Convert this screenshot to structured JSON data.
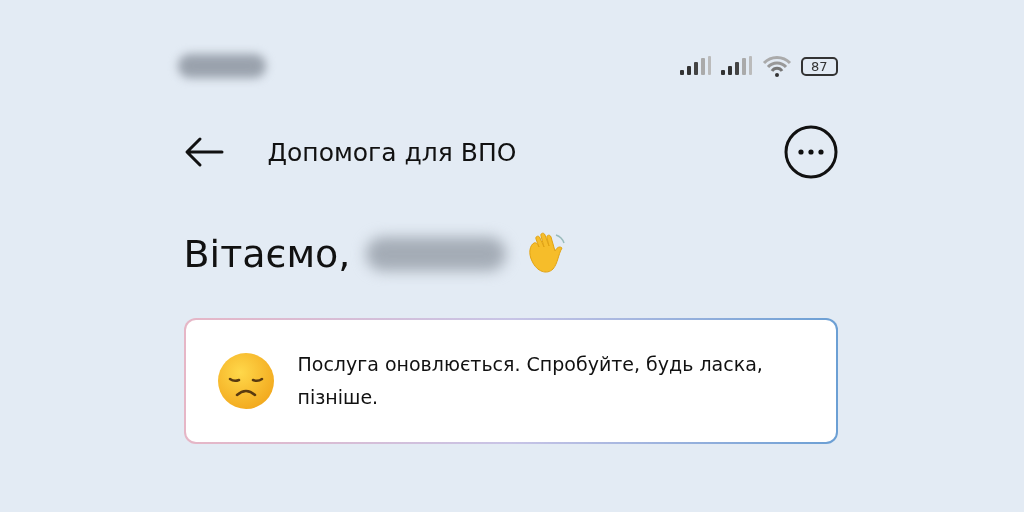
{
  "status_bar": {
    "battery": "87"
  },
  "header": {
    "title": "Допомога для ВПО"
  },
  "greeting": {
    "text": "Вітаємо,"
  },
  "notice": {
    "text": "Послуга оновлюється. Спробуйте, будь ласка, пізніше."
  }
}
